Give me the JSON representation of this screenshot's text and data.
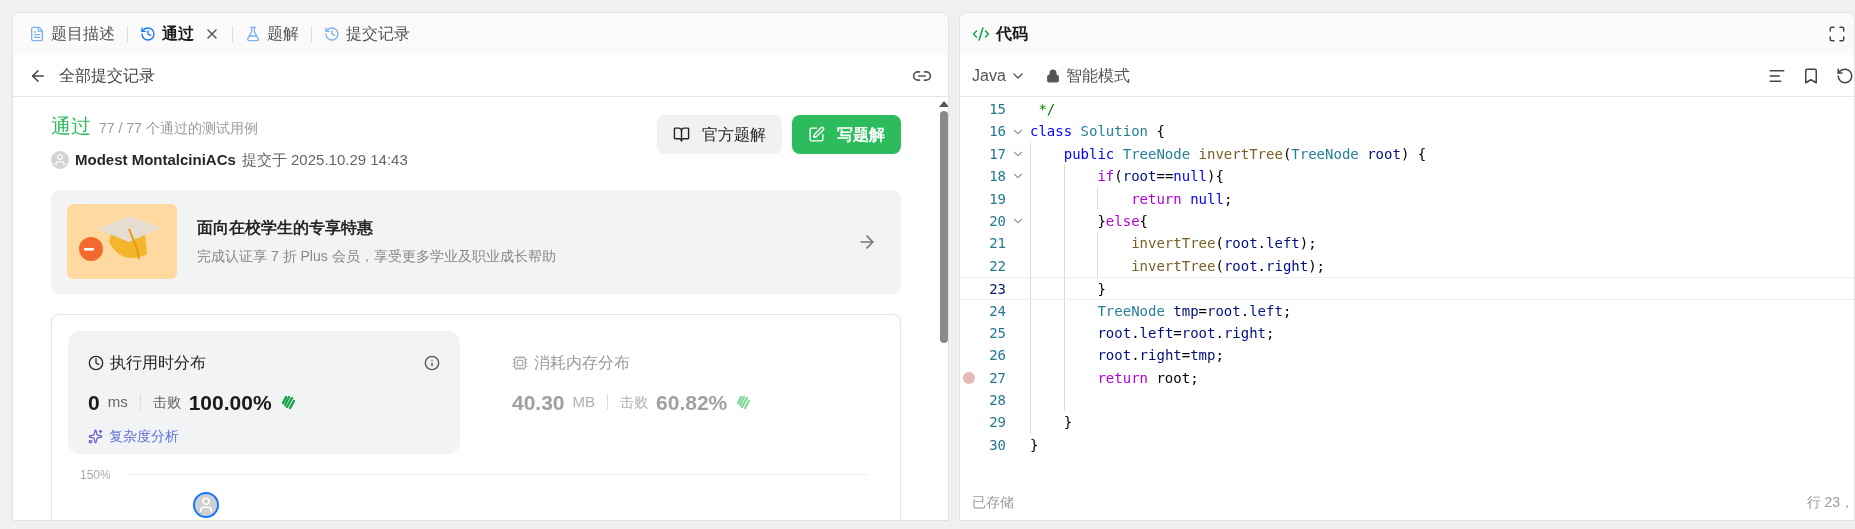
{
  "left_panel": {
    "tabs": [
      {
        "label": "题目描述",
        "selected": false,
        "closable": false
      },
      {
        "label": "通过",
        "selected": true,
        "closable": true
      },
      {
        "label": "题解",
        "selected": false,
        "closable": false
      },
      {
        "label": "提交记录",
        "selected": false,
        "closable": false
      }
    ],
    "back_link": "全部提交记录",
    "result": {
      "status": "通过",
      "detail": "77 / 77 个通过的测试用例",
      "author": "Modest MontalciniACs",
      "submitted": "提交于 2025.10.29 14:43"
    },
    "buttons": [
      {
        "label": "官方题解",
        "kind": "secondary"
      },
      {
        "label": "写题解",
        "kind": "primary"
      }
    ],
    "promo": {
      "title": "面向在校学生的专享特惠",
      "subtitle": "完成认证享 7 折 Plus 会员，享受更多学业及职业成长帮助"
    },
    "stats": [
      {
        "title": "执行用时分布",
        "selected": true,
        "value": "0",
        "unit": "ms",
        "beat_label": "击败",
        "beat": "100.00%",
        "extra": "复杂度分析"
      },
      {
        "title": "消耗内存分布",
        "selected": false,
        "value": "40.30",
        "unit": "MB",
        "beat_label": "击败",
        "beat": "60.82%"
      }
    ],
    "chart_top_label": "150%"
  },
  "right_panel": {
    "title": "代码",
    "language": "Java",
    "mode": "智能模式",
    "status": "已存储",
    "cursor": "行 23，",
    "lines": [
      {
        "number": "15",
        "fold": false,
        "breakpoint": false,
        "current": false,
        "tokens": [
          {
            "kind": "comment",
            "text": " */"
          }
        ]
      },
      {
        "number": "16",
        "fold": true,
        "breakpoint": false,
        "current": false,
        "tokens": [
          {
            "kind": "keyword",
            "text": "class"
          },
          {
            "kind": "type",
            "text": " Solution"
          },
          {
            "kind": "plain",
            "text": " {"
          }
        ]
      },
      {
        "number": "17",
        "fold": true,
        "breakpoint": false,
        "current": false,
        "tokens": [
          {
            "kind": "keyword",
            "text": "    public"
          },
          {
            "kind": "type",
            "text": " TreeNode"
          },
          {
            "kind": "function",
            "text": " invertTree"
          },
          {
            "kind": "plain",
            "text": "("
          },
          {
            "kind": "type",
            "text": "TreeNode"
          },
          {
            "kind": "variable",
            "text": " root"
          },
          {
            "kind": "plain",
            "text": ") {"
          }
        ]
      },
      {
        "number": "18",
        "fold": true,
        "breakpoint": false,
        "current": false,
        "tokens": [
          {
            "kind": "control",
            "text": "        if"
          },
          {
            "kind": "plain",
            "text": "("
          },
          {
            "kind": "variable",
            "text": "root"
          },
          {
            "kind": "plain",
            "text": "=="
          },
          {
            "kind": "keyword",
            "text": "null"
          },
          {
            "kind": "plain",
            "text": "){"
          }
        ]
      },
      {
        "number": "19",
        "fold": false,
        "breakpoint": false,
        "current": false,
        "tokens": [
          {
            "kind": "control",
            "text": "            return"
          },
          {
            "kind": "keyword",
            "text": " null"
          },
          {
            "kind": "plain",
            "text": ";"
          }
        ]
      },
      {
        "number": "20",
        "fold": true,
        "breakpoint": false,
        "current": false,
        "tokens": [
          {
            "kind": "plain",
            "text": "        }"
          },
          {
            "kind": "control",
            "text": "else"
          },
          {
            "kind": "plain",
            "text": "{"
          }
        ]
      },
      {
        "number": "21",
        "fold": false,
        "breakpoint": false,
        "current": false,
        "tokens": [
          {
            "kind": "function",
            "text": "            invertTree"
          },
          {
            "kind": "plain",
            "text": "("
          },
          {
            "kind": "variable",
            "text": "root"
          },
          {
            "kind": "plain",
            "text": "."
          },
          {
            "kind": "variable",
            "text": "left"
          },
          {
            "kind": "plain",
            "text": ");"
          }
        ]
      },
      {
        "number": "22",
        "fold": false,
        "breakpoint": false,
        "current": false,
        "tokens": [
          {
            "kind": "function",
            "text": "            invertTree"
          },
          {
            "kind": "plain",
            "text": "("
          },
          {
            "kind": "variable",
            "text": "root"
          },
          {
            "kind": "plain",
            "text": "."
          },
          {
            "kind": "variable",
            "text": "right"
          },
          {
            "kind": "plain",
            "text": ");"
          }
        ]
      },
      {
        "number": "23",
        "fold": false,
        "breakpoint": false,
        "current": true,
        "tokens": [
          {
            "kind": "plain",
            "text": "        }"
          }
        ]
      },
      {
        "number": "24",
        "fold": false,
        "breakpoint": false,
        "current": false,
        "tokens": [
          {
            "kind": "type",
            "text": "        TreeNode"
          },
          {
            "kind": "variable",
            "text": " tmp"
          },
          {
            "kind": "plain",
            "text": "="
          },
          {
            "kind": "variable",
            "text": "root"
          },
          {
            "kind": "plain",
            "text": "."
          },
          {
            "kind": "variable",
            "text": "left"
          },
          {
            "kind": "plain",
            "text": ";"
          }
        ]
      },
      {
        "number": "25",
        "fold": false,
        "breakpoint": false,
        "current": false,
        "tokens": [
          {
            "kind": "variable",
            "text": "        root"
          },
          {
            "kind": "plain",
            "text": "."
          },
          {
            "kind": "variable",
            "text": "left"
          },
          {
            "kind": "plain",
            "text": "="
          },
          {
            "kind": "variable",
            "text": "root"
          },
          {
            "kind": "plain",
            "text": "."
          },
          {
            "kind": "variable",
            "text": "right"
          },
          {
            "kind": "plain",
            "text": ";"
          }
        ]
      },
      {
        "number": "26",
        "fold": false,
        "breakpoint": false,
        "current": false,
        "tokens": [
          {
            "kind": "variable",
            "text": "        root"
          },
          {
            "kind": "plain",
            "text": "."
          },
          {
            "kind": "variable",
            "text": "right"
          },
          {
            "kind": "plain",
            "text": "="
          },
          {
            "kind": "variable",
            "text": "tmp"
          },
          {
            "kind": "plain",
            "text": ";"
          }
        ]
      },
      {
        "number": "27",
        "fold": false,
        "breakpoint": true,
        "current": false,
        "tokens": [
          {
            "kind": "control",
            "text": "        return"
          },
          {
            "kind": "plain",
            "text": " root;"
          }
        ]
      },
      {
        "number": "28",
        "fold": false,
        "breakpoint": false,
        "current": false
      },
      {
        "number": "29",
        "fold": false,
        "breakpoint": false,
        "current": false,
        "tokens": [
          {
            "kind": "plain",
            "text": "    }"
          }
        ]
      },
      {
        "number": "30",
        "fold": false,
        "breakpoint": false,
        "current": false,
        "tokens": [
          {
            "kind": "plain",
            "text": "}"
          }
        ]
      }
    ]
  }
}
